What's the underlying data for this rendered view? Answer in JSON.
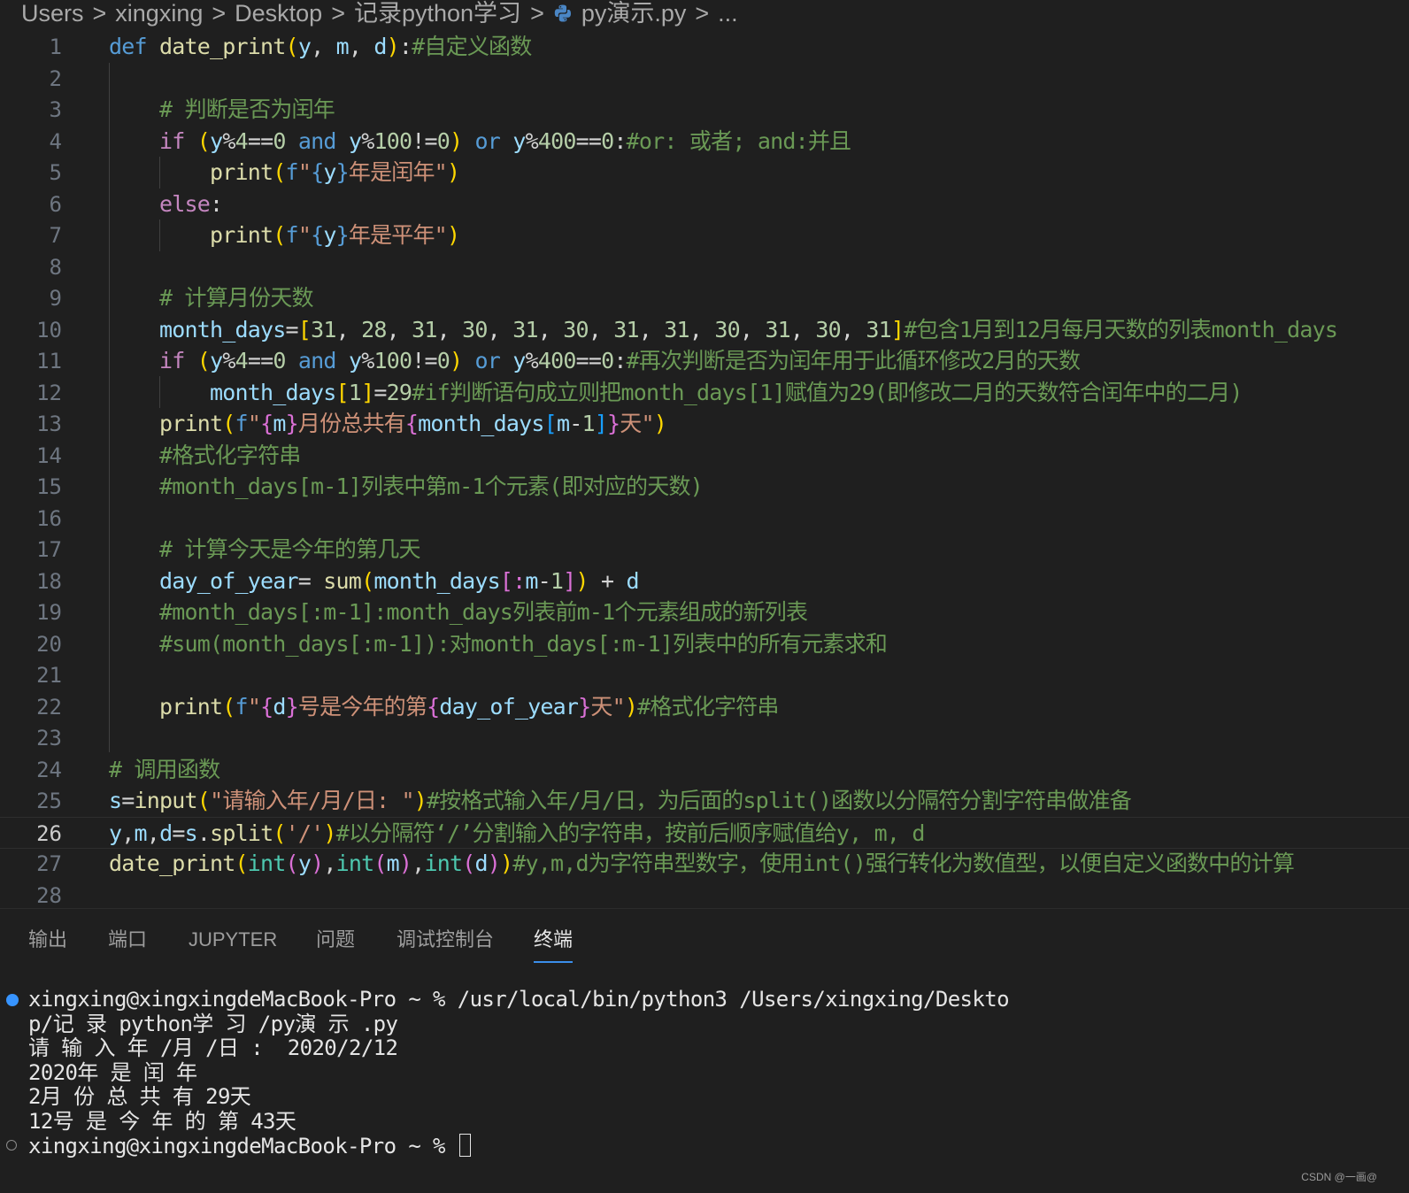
{
  "breadcrumb": {
    "segments": [
      "Users",
      "xingxing",
      "Desktop",
      "记录python学习",
      "py演示.py",
      "..."
    ],
    "separator": ">"
  },
  "editor": {
    "active_line": 26,
    "lines": [
      {
        "n": "1",
        "tokens": [
          [
            "kw-blue",
            "def"
          ],
          [
            "op",
            " "
          ],
          [
            "fn",
            "date_print"
          ],
          [
            "b1",
            "("
          ],
          [
            "var",
            "y"
          ],
          [
            "op",
            ", "
          ],
          [
            "var",
            "m"
          ],
          [
            "op",
            ", "
          ],
          [
            "var",
            "d"
          ],
          [
            "b1",
            ")"
          ],
          [
            "op",
            ":"
          ],
          [
            "cm",
            "#自定义函数"
          ]
        ]
      },
      {
        "n": "2",
        "tokens": []
      },
      {
        "n": "3",
        "tokens": [
          [
            "op",
            "    "
          ],
          [
            "cm",
            "# 判断是否为闰年"
          ]
        ]
      },
      {
        "n": "4",
        "tokens": [
          [
            "op",
            "    "
          ],
          [
            "kw-purple",
            "if"
          ],
          [
            "op",
            " "
          ],
          [
            "b1",
            "("
          ],
          [
            "var",
            "y"
          ],
          [
            "op",
            "%"
          ],
          [
            "num",
            "4"
          ],
          [
            "op",
            "=="
          ],
          [
            "num",
            "0"
          ],
          [
            "op",
            " "
          ],
          [
            "kw-blue",
            "and"
          ],
          [
            "op",
            " "
          ],
          [
            "var",
            "y"
          ],
          [
            "op",
            "%"
          ],
          [
            "num",
            "100"
          ],
          [
            "op",
            "!="
          ],
          [
            "num",
            "0"
          ],
          [
            "b1",
            ")"
          ],
          [
            "op",
            " "
          ],
          [
            "kw-blue",
            "or"
          ],
          [
            "op",
            " "
          ],
          [
            "var",
            "y"
          ],
          [
            "op",
            "%"
          ],
          [
            "num",
            "400"
          ],
          [
            "op",
            "=="
          ],
          [
            "num",
            "0"
          ],
          [
            "op",
            ":"
          ],
          [
            "cm",
            "#or: 或者; and:并且"
          ]
        ]
      },
      {
        "n": "5",
        "tokens": [
          [
            "op",
            "        "
          ],
          [
            "fn",
            "print"
          ],
          [
            "b1",
            "("
          ],
          [
            "kw-blue",
            "f"
          ],
          [
            "str",
            "\""
          ],
          [
            "kw-blue",
            "{"
          ],
          [
            "var",
            "y"
          ],
          [
            "kw-blue",
            "}"
          ],
          [
            "str",
            "年是闰年\""
          ],
          [
            "b1",
            ")"
          ]
        ]
      },
      {
        "n": "6",
        "tokens": [
          [
            "op",
            "    "
          ],
          [
            "kw-purple",
            "else"
          ],
          [
            "op",
            ":"
          ]
        ]
      },
      {
        "n": "7",
        "tokens": [
          [
            "op",
            "        "
          ],
          [
            "fn",
            "print"
          ],
          [
            "b1",
            "("
          ],
          [
            "kw-blue",
            "f"
          ],
          [
            "str",
            "\""
          ],
          [
            "kw-blue",
            "{"
          ],
          [
            "var",
            "y"
          ],
          [
            "kw-blue",
            "}"
          ],
          [
            "str",
            "年是平年\""
          ],
          [
            "b1",
            ")"
          ]
        ]
      },
      {
        "n": "8",
        "tokens": []
      },
      {
        "n": "9",
        "tokens": [
          [
            "op",
            "    "
          ],
          [
            "cm",
            "# 计算月份天数"
          ]
        ]
      },
      {
        "n": "10",
        "tokens": [
          [
            "op",
            "    "
          ],
          [
            "var",
            "month_days"
          ],
          [
            "op",
            "="
          ],
          [
            "b1",
            "["
          ],
          [
            "num",
            "31"
          ],
          [
            "op",
            ", "
          ],
          [
            "num",
            "28"
          ],
          [
            "op",
            ", "
          ],
          [
            "num",
            "31"
          ],
          [
            "op",
            ", "
          ],
          [
            "num",
            "30"
          ],
          [
            "op",
            ", "
          ],
          [
            "num",
            "31"
          ],
          [
            "op",
            ", "
          ],
          [
            "num",
            "30"
          ],
          [
            "op",
            ", "
          ],
          [
            "num",
            "31"
          ],
          [
            "op",
            ", "
          ],
          [
            "num",
            "31"
          ],
          [
            "op",
            ", "
          ],
          [
            "num",
            "30"
          ],
          [
            "op",
            ", "
          ],
          [
            "num",
            "31"
          ],
          [
            "op",
            ", "
          ],
          [
            "num",
            "30"
          ],
          [
            "op",
            ", "
          ],
          [
            "num",
            "31"
          ],
          [
            "b1",
            "]"
          ],
          [
            "cm",
            "#包含1月到12月每月天数的列表month_days"
          ]
        ]
      },
      {
        "n": "11",
        "tokens": [
          [
            "op",
            "    "
          ],
          [
            "kw-purple",
            "if"
          ],
          [
            "op",
            " "
          ],
          [
            "b1",
            "("
          ],
          [
            "var",
            "y"
          ],
          [
            "op",
            "%"
          ],
          [
            "num",
            "4"
          ],
          [
            "op",
            "=="
          ],
          [
            "num",
            "0"
          ],
          [
            "op",
            " "
          ],
          [
            "kw-blue",
            "and"
          ],
          [
            "op",
            " "
          ],
          [
            "var",
            "y"
          ],
          [
            "op",
            "%"
          ],
          [
            "num",
            "100"
          ],
          [
            "op",
            "!="
          ],
          [
            "num",
            "0"
          ],
          [
            "b1",
            ")"
          ],
          [
            "op",
            " "
          ],
          [
            "kw-blue",
            "or"
          ],
          [
            "op",
            " "
          ],
          [
            "var",
            "y"
          ],
          [
            "op",
            "%"
          ],
          [
            "num",
            "400"
          ],
          [
            "op",
            "=="
          ],
          [
            "num",
            "0"
          ],
          [
            "op",
            ":"
          ],
          [
            "cm",
            "#再次判断是否为闰年用于此循环修改2月的天数"
          ]
        ]
      },
      {
        "n": "12",
        "tokens": [
          [
            "op",
            "        "
          ],
          [
            "var",
            "month_days"
          ],
          [
            "b1",
            "["
          ],
          [
            "num",
            "1"
          ],
          [
            "b1",
            "]"
          ],
          [
            "op",
            "="
          ],
          [
            "num",
            "29"
          ],
          [
            "cm",
            "#if判断语句成立则把month_days[1]赋值为29(即修改二月的天数符合闰年中的二月)"
          ]
        ]
      },
      {
        "n": "13",
        "tokens": [
          [
            "op",
            "    "
          ],
          [
            "fn",
            "print"
          ],
          [
            "b1",
            "("
          ],
          [
            "kw-blue",
            "f"
          ],
          [
            "str",
            "\""
          ],
          [
            "b2",
            "{"
          ],
          [
            "var",
            "m"
          ],
          [
            "b2",
            "}"
          ],
          [
            "str",
            "月份总共有"
          ],
          [
            "b2",
            "{"
          ],
          [
            "var",
            "month_days"
          ],
          [
            "b3",
            "["
          ],
          [
            "var",
            "m"
          ],
          [
            "op",
            "-"
          ],
          [
            "num",
            "1"
          ],
          [
            "b3",
            "]"
          ],
          [
            "b2",
            "}"
          ],
          [
            "str",
            "天\""
          ],
          [
            "b1",
            ")"
          ]
        ]
      },
      {
        "n": "14",
        "tokens": [
          [
            "op",
            "    "
          ],
          [
            "cm",
            "#格式化字符串"
          ]
        ]
      },
      {
        "n": "15",
        "tokens": [
          [
            "op",
            "    "
          ],
          [
            "cm",
            "#month_days[m-1]列表中第m-1个元素(即对应的天数)"
          ]
        ]
      },
      {
        "n": "16",
        "tokens": []
      },
      {
        "n": "17",
        "tokens": [
          [
            "op",
            "    "
          ],
          [
            "cm",
            "# 计算今天是今年的第几天"
          ]
        ]
      },
      {
        "n": "18",
        "tokens": [
          [
            "op",
            "    "
          ],
          [
            "var",
            "day_of_year"
          ],
          [
            "op",
            "= "
          ],
          [
            "fn",
            "sum"
          ],
          [
            "b1",
            "("
          ],
          [
            "var",
            "month_days"
          ],
          [
            "b2",
            "[:"
          ],
          [
            "var",
            "m"
          ],
          [
            "op",
            "-"
          ],
          [
            "num",
            "1"
          ],
          [
            "b2",
            "]"
          ],
          [
            "b1",
            ")"
          ],
          [
            "op",
            " + "
          ],
          [
            "var",
            "d"
          ]
        ]
      },
      {
        "n": "19",
        "tokens": [
          [
            "op",
            "    "
          ],
          [
            "cm",
            "#month_days[:m-1]:month_days列表前m-1个元素组成的新列表"
          ]
        ]
      },
      {
        "n": "20",
        "tokens": [
          [
            "op",
            "    "
          ],
          [
            "cm",
            "#sum(month_days[:m-1]):对month_days[:m-1]列表中的所有元素求和"
          ]
        ]
      },
      {
        "n": "21",
        "tokens": []
      },
      {
        "n": "22",
        "tokens": [
          [
            "op",
            "    "
          ],
          [
            "fn",
            "print"
          ],
          [
            "b1",
            "("
          ],
          [
            "kw-blue",
            "f"
          ],
          [
            "str",
            "\""
          ],
          [
            "b2",
            "{"
          ],
          [
            "var",
            "d"
          ],
          [
            "b2",
            "}"
          ],
          [
            "str",
            "号是今年的第"
          ],
          [
            "b2",
            "{"
          ],
          [
            "var",
            "day_of_year"
          ],
          [
            "b2",
            "}"
          ],
          [
            "str",
            "天\""
          ],
          [
            "b1",
            ")"
          ],
          [
            "cm",
            "#格式化字符串"
          ]
        ]
      },
      {
        "n": "23",
        "tokens": []
      },
      {
        "n": "24",
        "tokens": [
          [
            "cm",
            "# 调用函数"
          ]
        ]
      },
      {
        "n": "25",
        "tokens": [
          [
            "var",
            "s"
          ],
          [
            "op",
            "="
          ],
          [
            "fn",
            "input"
          ],
          [
            "b1",
            "("
          ],
          [
            "str",
            "\"请输入年/月/日: \""
          ],
          [
            "b1",
            ")"
          ],
          [
            "cm",
            "#按格式输入年/月/日，为后面的split()函数以分隔符分割字符串做准备"
          ]
        ]
      },
      {
        "n": "26",
        "tokens": [
          [
            "var",
            "y"
          ],
          [
            "op",
            ","
          ],
          [
            "var",
            "m"
          ],
          [
            "op",
            ","
          ],
          [
            "var",
            "d"
          ],
          [
            "op",
            "="
          ],
          [
            "var",
            "s"
          ],
          [
            "op",
            "."
          ],
          [
            "fn",
            "split"
          ],
          [
            "b1",
            "("
          ],
          [
            "str",
            "'/'"
          ],
          [
            "b1",
            ")"
          ],
          [
            "cm",
            "#以分隔符‘/’分割输入的字符串，按前后顺序赋值给y, m, d"
          ]
        ]
      },
      {
        "n": "27",
        "tokens": [
          [
            "fn",
            "date_print"
          ],
          [
            "b1",
            "("
          ],
          [
            "cls",
            "int"
          ],
          [
            "b2",
            "("
          ],
          [
            "var",
            "y"
          ],
          [
            "b2",
            ")"
          ],
          [
            "op",
            ","
          ],
          [
            "cls",
            "int"
          ],
          [
            "b2",
            "("
          ],
          [
            "var",
            "m"
          ],
          [
            "b2",
            ")"
          ],
          [
            "op",
            ","
          ],
          [
            "cls",
            "int"
          ],
          [
            "b2",
            "("
          ],
          [
            "var",
            "d"
          ],
          [
            "b2",
            ")"
          ],
          [
            "b1",
            ")"
          ],
          [
            "cm",
            "#y,m,d为字符串型数字，使用int()强行转化为数值型，以便自定义函数中的计算"
          ]
        ]
      },
      {
        "n": "28",
        "tokens": []
      }
    ]
  },
  "panel": {
    "tabs": [
      "输出",
      "端口",
      "JUPYTER",
      "问题",
      "调试控制台",
      "终端"
    ],
    "active_tab": "终端"
  },
  "terminal": {
    "lines": [
      "xingxing@xingxingdeMacBook-Pro ~ % /usr/local/bin/python3 /Users/xingxing/Deskto",
      "p/记 录 python学 习 /py演 示 .py",
      "请 输 入 年 /月 /日 :  2020/2/12",
      "2020年 是 闰 年",
      "2月 份 总 共 有 29天",
      "12号 是 今 年 的 第 43天",
      "xingxing@xingxingdeMacBook-Pro ~ % "
    ]
  },
  "watermark": "CSDN @一画@"
}
